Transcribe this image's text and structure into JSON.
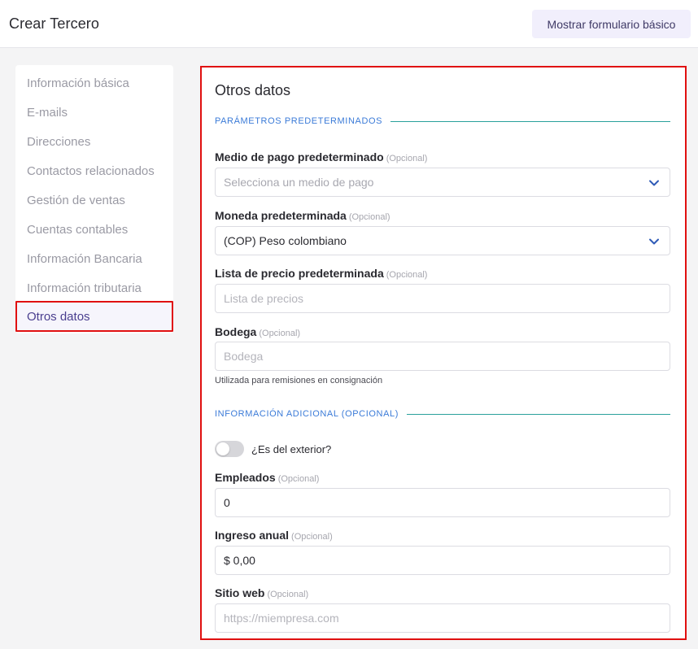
{
  "header": {
    "title": "Crear Tercero",
    "basic_form_button": "Mostrar formulario básico"
  },
  "sidebar": {
    "items": [
      {
        "label": "Información básica"
      },
      {
        "label": "E-mails"
      },
      {
        "label": "Direcciones"
      },
      {
        "label": "Contactos relacionados"
      },
      {
        "label": "Gestión de ventas"
      },
      {
        "label": "Cuentas contables"
      },
      {
        "label": "Información Bancaria"
      },
      {
        "label": "Información tributaria"
      },
      {
        "label": "Otros datos",
        "active": true
      }
    ]
  },
  "panel": {
    "title": "Otros datos",
    "section_defaults": "PARÁMETROS PREDETERMINADOS",
    "section_additional": "INFORMACIÓN ADICIONAL (OPCIONAL)",
    "optional_tag": "(Opcional)",
    "payment_method": {
      "label": "Medio de pago predeterminado",
      "placeholder": "Selecciona un medio de pago"
    },
    "currency": {
      "label": "Moneda predeterminada",
      "value": "(COP) Peso colombiano"
    },
    "price_list": {
      "label": "Lista de precio predeterminada",
      "placeholder": "Lista de precios"
    },
    "warehouse": {
      "label": "Bodega",
      "placeholder": "Bodega",
      "hint": "Utilizada para remisiones en consignación"
    },
    "is_foreign": {
      "label": "¿Es del exterior?",
      "checked": false
    },
    "employees": {
      "label": "Empleados",
      "value": "0"
    },
    "annual_income": {
      "label": "Ingreso anual",
      "value": "$ 0,00"
    },
    "website": {
      "label": "Sitio web",
      "placeholder": "https://miempresa.com"
    }
  },
  "colors": {
    "accent": "#3b7bd8",
    "divider": "#2aa19c",
    "highlight": "#e01010",
    "chevron": "#2f5bb7"
  }
}
